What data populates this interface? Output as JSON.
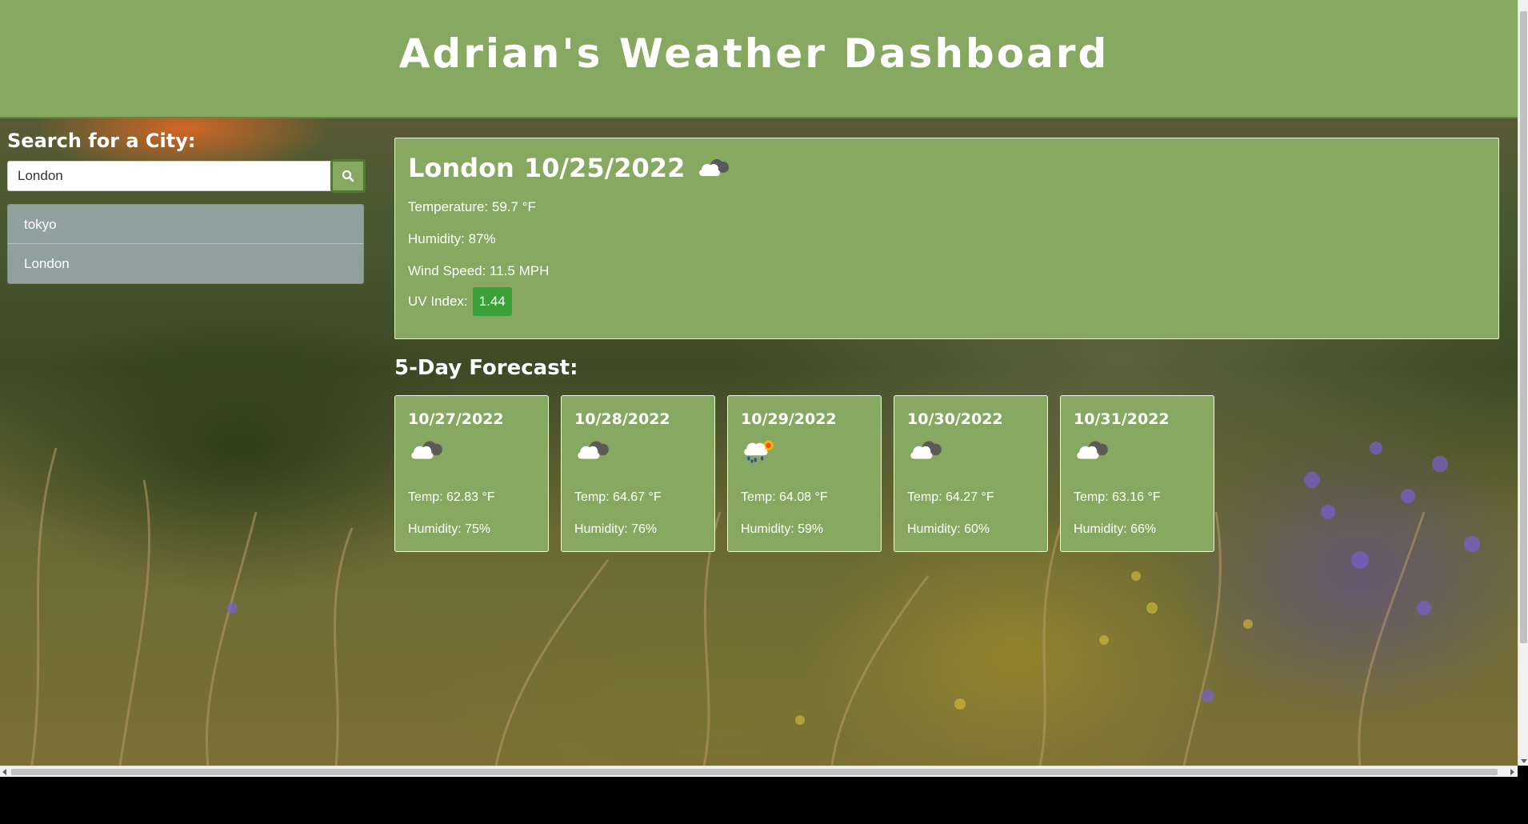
{
  "header": {
    "title": "Adrian's Weather Dashboard"
  },
  "search": {
    "heading": "Search for a City:",
    "input_value": "London",
    "button_icon": "search-icon"
  },
  "history": [
    "tokyo",
    "London"
  ],
  "current": {
    "city": "London",
    "date": "10/25/2022",
    "icon": "broken-clouds-icon",
    "temperature": "Temperature: 59.7 °F",
    "humidity": "Humidity: 87%",
    "wind": "Wind Speed: 11.5 MPH",
    "uv_label": "UV Index:",
    "uv_value": "1.44",
    "uv_color": "#3aa13a"
  },
  "forecast": {
    "heading": "5-Day Forecast:",
    "days": [
      {
        "date": "10/27/2022",
        "icon": "broken-clouds-icon",
        "temp": "Temp: 62.83 °F",
        "humidity": "Humidity: 75%"
      },
      {
        "date": "10/28/2022",
        "icon": "broken-clouds-icon",
        "temp": "Temp: 64.67 °F",
        "humidity": "Humidity: 76%"
      },
      {
        "date": "10/29/2022",
        "icon": "rain-icon",
        "temp": "Temp: 64.08 °F",
        "humidity": "Humidity: 59%"
      },
      {
        "date": "10/30/2022",
        "icon": "broken-clouds-icon",
        "temp": "Temp: 64.27 °F",
        "humidity": "Humidity: 60%"
      },
      {
        "date": "10/31/2022",
        "icon": "broken-clouds-icon",
        "temp": "Temp: 63.16 °F",
        "humidity": "Humidity: 66%"
      }
    ]
  },
  "colors": {
    "accent_green": "#86a860",
    "history_item": "#94a3a3",
    "uv_low": "#3aa13a"
  }
}
